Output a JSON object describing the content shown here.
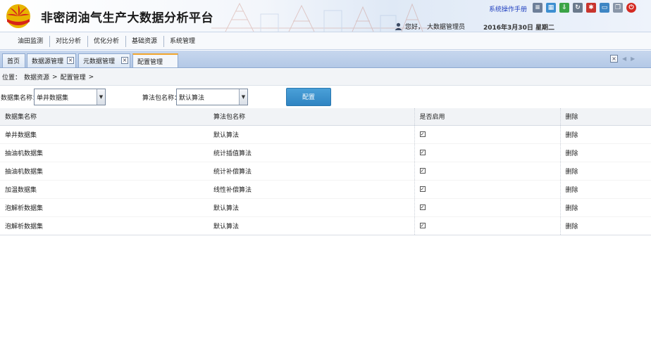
{
  "header": {
    "title": "非密闭油气生产大数据分析平台",
    "manual_link": "系统操作手册",
    "greeting": "您好，",
    "user_name": "大数据管理员",
    "date": "2016年3月30日 星期二",
    "toolbar_icons": [
      "list-icon",
      "grid-icon",
      "download-icon",
      "refresh-icon",
      "settings-icon",
      "monitor-icon",
      "window-icon",
      "power-icon"
    ]
  },
  "menu": {
    "items": [
      "油田监测",
      "对比分析",
      "优化分析",
      "基础资源",
      "系统管理"
    ]
  },
  "tabs": [
    {
      "label": "首页",
      "closable": false
    },
    {
      "label": "数据源管理",
      "closable": true
    },
    {
      "label": "元数据管理",
      "closable": true
    },
    {
      "label": "配置管理",
      "closable": false,
      "active": true
    }
  ],
  "breadcrumb": {
    "label": "位置：",
    "items": [
      "数据资源",
      "配置管理"
    ],
    "separator": ">"
  },
  "filters": {
    "dataset_label": "数据集名称：",
    "dataset_value": "单井数据集",
    "algo_label": "算法包名称：",
    "algo_value": "默认算法",
    "config_button": "配置"
  },
  "table": {
    "columns": [
      "数据集名称",
      "算法包名称",
      "是否启用",
      "删除"
    ],
    "rows": [
      {
        "dataset": "单井数据集",
        "algorithm": "默认算法",
        "enabled": true,
        "delete": "删除"
      },
      {
        "dataset": "抽油机数据集",
        "algorithm": "统计插值算法",
        "enabled": true,
        "delete": "删除"
      },
      {
        "dataset": "抽油机数据集",
        "algorithm": "统计补偿算法",
        "enabled": true,
        "delete": "删除"
      },
      {
        "dataset": "加温数据集",
        "algorithm": "线性补偿算法",
        "enabled": true,
        "delete": "删除"
      },
      {
        "dataset": "泡解析数据集",
        "algorithm": "默认算法",
        "enabled": true,
        "delete": "删除"
      },
      {
        "dataset": "泡解析数据集",
        "algorithm": "默认算法",
        "enabled": true,
        "delete": "删除"
      }
    ]
  },
  "colors": {
    "accent_blue": "#2f84c2",
    "tab_active_border": "#f1a52c",
    "link_blue": "#1f3fbf"
  }
}
